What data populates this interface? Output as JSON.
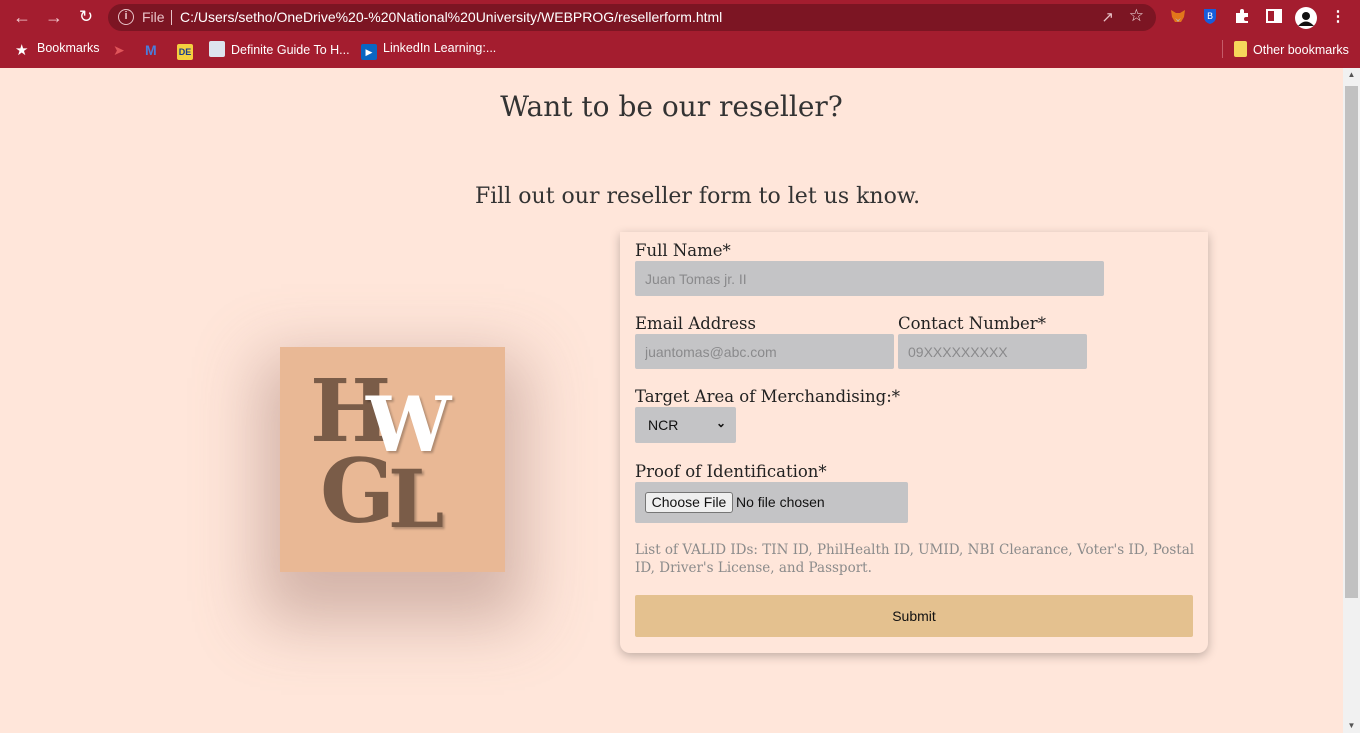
{
  "browser": {
    "omnibox": {
      "protocol_label": "File",
      "url": "C:/Users/setho/OneDrive%20-%20National%20University/WEBPROG/resellerform.html"
    },
    "bookmarks_bar": {
      "items": [
        {
          "label": "Bookmarks"
        },
        {
          "label": "Definite Guide To H..."
        },
        {
          "label": "LinkedIn Learning:..."
        }
      ],
      "other_label": "Other bookmarks"
    }
  },
  "page": {
    "heading": "Want to be our reseller?",
    "subheading": "Fill out our reseller form to let us know.",
    "logo": {
      "letters": [
        "H",
        "W",
        "G",
        "L"
      ],
      "colors": {
        "background": "#e9b895",
        "dark": "#7a5c48",
        "light": "#ffffff"
      }
    },
    "form": {
      "full_name": {
        "label": "Full Name*",
        "placeholder": "Juan Tomas jr. II"
      },
      "email": {
        "label": "Email Address",
        "placeholder": "juantomas@abc.com"
      },
      "contact": {
        "label": "Contact Number*",
        "placeholder": "09XXXXXXXXX"
      },
      "target_area": {
        "label": "Target Area of Merchandising:*",
        "selected": "NCR"
      },
      "proof_id": {
        "label": "Proof of Identification*",
        "button_label": "Choose File",
        "status": "No file chosen"
      },
      "valid_ids_note": "List of VALID IDs: TIN ID, PhilHealth ID, UMID, NBI Clearance, Voter's ID, Postal ID, Driver's License, and Passport.",
      "submit_label": "Submit"
    }
  },
  "colors": {
    "chrome": "#a41d2f",
    "page_bg": "#ffe6da",
    "field_bg": "#c4c4c6",
    "submit_bg": "#e4c18f"
  }
}
